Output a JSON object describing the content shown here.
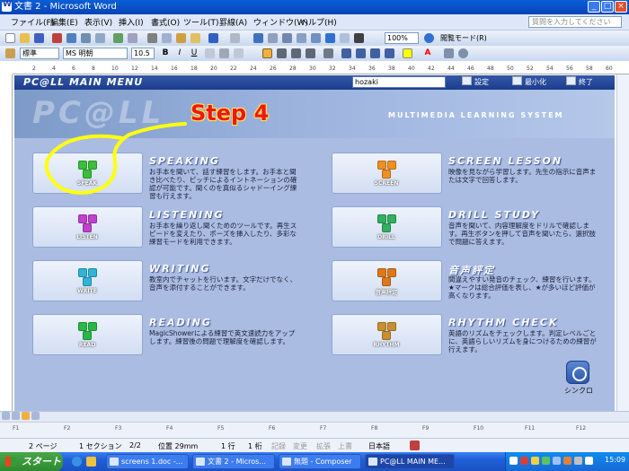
{
  "window": {
    "title": "文書 2 - Microsoft Word"
  },
  "menu": {
    "items": [
      "ファイル(F)",
      "編集(E)",
      "表示(V)",
      "挿入(I)",
      "書式(O)",
      "ツール(T)",
      "罫線(A)",
      "ウィンドウ(W)",
      "ヘルプ(H)"
    ],
    "help_placeholder": "質問を入力してください"
  },
  "toolbar": {
    "zoom": "100%",
    "reading_mode": "閲覧モード(R)"
  },
  "format": {
    "style": "標準",
    "font": "MS 明朝",
    "size": "10.5",
    "bold": "B",
    "italic": "I",
    "underline": "U",
    "highlight_color": "#ffff00",
    "font_color": "#ff0000"
  },
  "ruler": {
    "marks": [
      "2",
      "4",
      "6",
      "8",
      "10",
      "12",
      "14",
      "16",
      "18",
      "20",
      "22",
      "24",
      "26",
      "28",
      "30",
      "32",
      "34",
      "36",
      "38",
      "40",
      "42",
      "44",
      "46",
      "48",
      "50",
      "52",
      "54",
      "56",
      "58",
      "60"
    ]
  },
  "app": {
    "title": "PC@LL MAIN MENU",
    "user": "hozaki",
    "buttons": {
      "settings": "設定",
      "minimize": "最小化",
      "exit": "終了"
    },
    "banner_logo": "PC@LL",
    "tagline": "MULTIMEDIA LEARNING SYSTEM",
    "annotation": "Step 4",
    "sync_label": "シンクロ",
    "modules": [
      {
        "title": "SPEAKING",
        "icon_label": "SPEAK",
        "color": "#38c038",
        "desc": "お手本を聞いて、話す練習をします。お手本と聞き比べたり、ピッチによるイントネーションの確認が可能です。聞くのを真似るシャドーイング練習も行えます。"
      },
      {
        "title": "SCREEN LESSON",
        "icon_label": "SCREEN",
        "color": "#f09020",
        "desc": "映像を見ながら学習します。先生の指示に音声または文字で回答します。"
      },
      {
        "title": "LISTENING",
        "icon_label": "LISTEN",
        "color": "#c040d0",
        "desc": "お手本を繰り返し聞くためのツールです。再生スピードを変えたり、ポーズを挿入したり、多彩な練習モードを利用できます。"
      },
      {
        "title": "DRILL STUDY",
        "icon_label": "DRILL",
        "color": "#30b060",
        "desc": "音声を聞いて、内容理解度をドリルで確認します。再生ボタンを押して音声を聞いたら、選択肢で問題に答えます。"
      },
      {
        "title": "WRITING",
        "icon_label": "WRITE",
        "color": "#2fb4d8",
        "desc": "教室内でチャットを行います。文字だけでなく、音声を添付することができます。"
      },
      {
        "title": "音声評定",
        "icon_label": "音声評定",
        "color": "#e07818",
        "desc": "間違えやすい発音のチェック、練習を行います。★マークは総合評価を表し、★が多いほど評価が高くなります。"
      },
      {
        "title": "READING",
        "icon_label": "READ",
        "color": "#28b848",
        "desc": "MagicShowerによる練習で英文速読力をアップします。練習後の問題で理解度を確認します。"
      },
      {
        "title": "RHYTHM CHECK",
        "icon_label": "RHYTHM",
        "color": "#c89030",
        "desc": "英語のリズムをチェックします。判定レベルごとに、英語らしいリズムを身につけるための練習が行えます。"
      }
    ]
  },
  "fkeys": [
    "F1",
    "F2",
    "F3",
    "F4",
    "F5",
    "F6",
    "F7",
    "F8",
    "F9",
    "F10",
    "F11",
    "F12"
  ],
  "status": {
    "page": "2 ページ",
    "section": "1 セクション",
    "pages": "2/2",
    "position": "位置 29mm",
    "line": "1 行",
    "column": "1 桁",
    "rec": "記録",
    "trk": "変更",
    "ext": "拡張",
    "ovr": "上書",
    "lang": "日本語"
  },
  "taskbar": {
    "start": "スタート",
    "tasks": [
      "screens 1.doc -...",
      "文書 2 - Micros...",
      "無題 - Composer",
      "PC@LL MAIN ME..."
    ],
    "clock": "15:09"
  }
}
